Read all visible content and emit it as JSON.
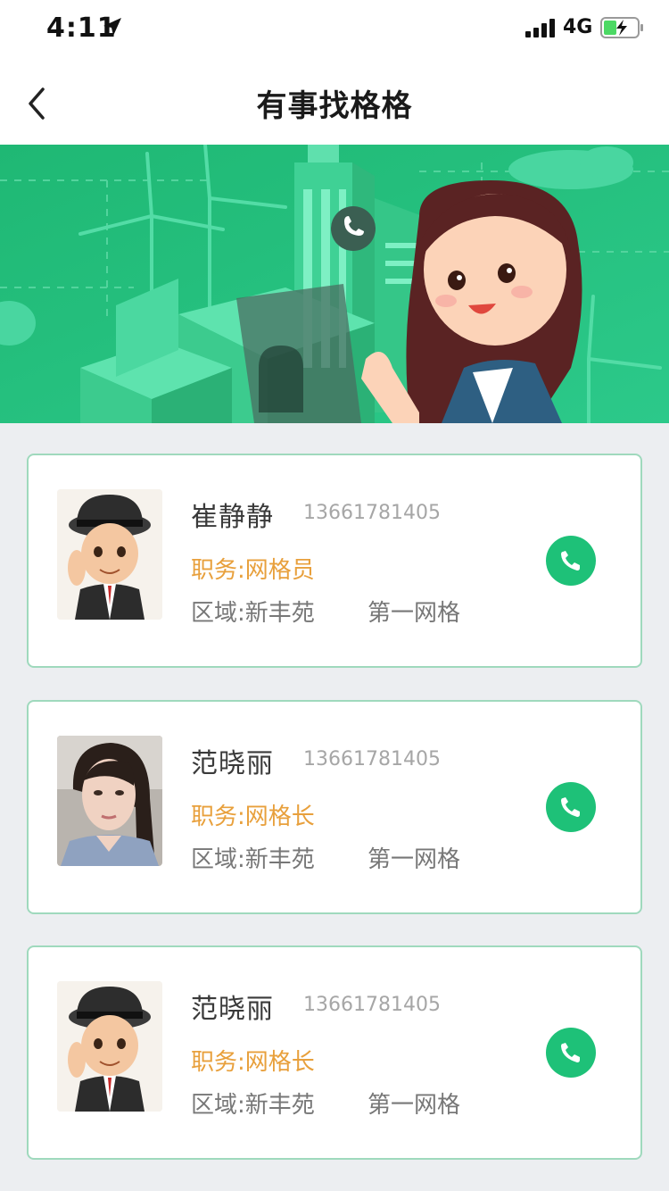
{
  "status_bar": {
    "time": "4:11",
    "network": "4G"
  },
  "nav": {
    "title": "有事找格格"
  },
  "colors": {
    "accent": "#1ec178",
    "duty": "#e8a03c",
    "card_border": "#9fd9bd",
    "banner": "#22c07a"
  },
  "contacts": [
    {
      "name": "崔静静",
      "phone": "13661781405",
      "duty": "职务:网格员",
      "area": "区域:新丰苑",
      "grid": "第一网格",
      "avatar": "cartoon-officer"
    },
    {
      "name": "范晓丽",
      "phone": "13661781405",
      "duty": "职务:网格长",
      "area": "区域:新丰苑",
      "grid": "第一网格",
      "avatar": "photo-woman"
    },
    {
      "name": "范晓丽",
      "phone": "13661781405",
      "duty": "职务:网格长",
      "area": "区域:新丰苑",
      "grid": "第一网格",
      "avatar": "cartoon-officer"
    }
  ],
  "icons": {
    "back": "chevron-left-icon",
    "call": "phone-icon"
  }
}
